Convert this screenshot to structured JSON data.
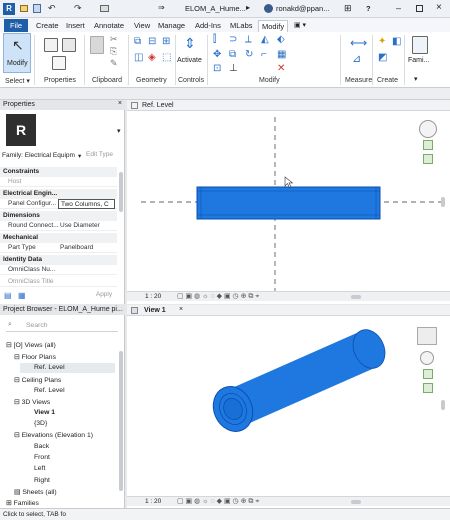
{
  "titlebar": {
    "doc_title": "ELOM_A_Hume...",
    "user": "ronakd@ppan...",
    "help": "?"
  },
  "tabs": [
    "File",
    "Create",
    "Insert",
    "Annotate",
    "View",
    "Manage",
    "Add-Ins",
    "MLabs",
    "Modify"
  ],
  "active_tab": "Modify",
  "ribbon": {
    "modify_label": "Modify",
    "select_label": "Select ▾",
    "groups": [
      "Properties",
      "Clipboard",
      "Geometry",
      "Controls",
      "Modify",
      "Measure",
      "Create"
    ],
    "activate_label": "Activate",
    "family_label": "Fami..."
  },
  "properties": {
    "title": "Properties",
    "family": "Family: Electrical Equipm",
    "edit_type": "Edit Type",
    "sections": {
      "constraints": "Constraints",
      "host_key": "Host",
      "electrical": "Electrical Engin...",
      "panel_key": "Panel Configur...",
      "panel_val": "Two Columns, C",
      "dimensions": "Dimensions",
      "round_key": "Round Connect...",
      "round_val": "Use Diameter",
      "mechanical": "Mechanical",
      "parttype_key": "Part Type",
      "parttype_val": "Panelboard",
      "identity": "Identity Data",
      "omni_num": "OmniClass Nu...",
      "omni_title": "OmniClass Title"
    },
    "apply": "Apply"
  },
  "view_top": {
    "tab": "Ref. Level",
    "scale": "1 : 20"
  },
  "view_bottom": {
    "tab": "View 1",
    "scale": "1 : 20"
  },
  "browser": {
    "title": "Project Browser - ELOM_A_Hume pi...",
    "search_placeholder": "Search",
    "items": {
      "views": "[O] Views (all)",
      "floor_plans": "Floor Plans",
      "fp_ref": "Ref. Level",
      "ceiling_plans": "Ceiling Plans",
      "cp_ref": "Ref. Level",
      "views3d": "3D Views",
      "view1": "View 1",
      "view3d": "{3D}",
      "elevations": "Elevations (Elevation 1)",
      "back": "Back",
      "front": "Front",
      "left": "Left",
      "right": "Right",
      "sheets": "Sheets (all)",
      "families": "Families"
    }
  },
  "status": {
    "text": "Click to select, TAB fo"
  },
  "colors": {
    "accent": "#1f5fa8",
    "model_blue": "#1e78e0",
    "model_dark": "#0a4fb0"
  }
}
